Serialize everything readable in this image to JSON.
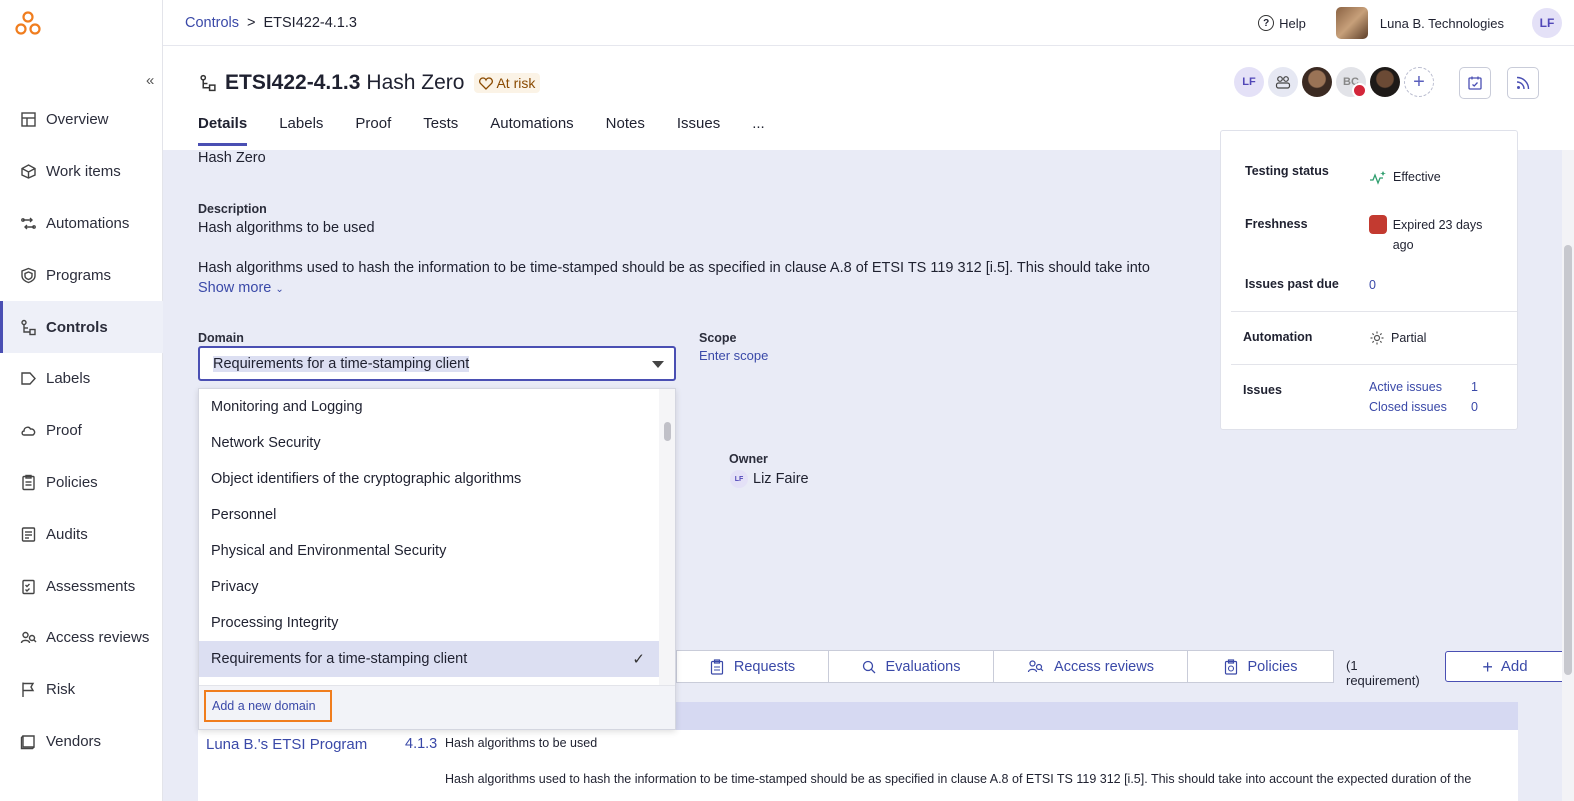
{
  "breadcrumb": {
    "root": "Controls",
    "sep": ">",
    "current": "ETSI422-4.1.3"
  },
  "topbar": {
    "help": "Help",
    "org": "Luna B. Technologies",
    "user_initials": "LF"
  },
  "control": {
    "code": "ETSI422-4.1.3",
    "name": "Hash Zero",
    "status": "At risk"
  },
  "tabs": [
    "Details",
    "Labels",
    "Proof",
    "Tests",
    "Automations",
    "Notes",
    "Issues",
    "..."
  ],
  "header_avatars": {
    "lf": "LF",
    "bc": "BC"
  },
  "sidebar": {
    "collapse": "«",
    "items": [
      {
        "label": "Overview",
        "icon": "overview-icon"
      },
      {
        "label": "Work items",
        "icon": "work-items-icon"
      },
      {
        "label": "Automations",
        "icon": "automations-icon"
      },
      {
        "label": "Programs",
        "icon": "programs-icon"
      },
      {
        "label": "Controls",
        "icon": "controls-icon"
      },
      {
        "label": "Labels",
        "icon": "labels-icon"
      },
      {
        "label": "Proof",
        "icon": "proof-icon"
      },
      {
        "label": "Policies",
        "icon": "policies-icon"
      },
      {
        "label": "Audits",
        "icon": "audits-icon"
      },
      {
        "label": "Assessments",
        "icon": "assessments-icon"
      },
      {
        "label": "Access reviews",
        "icon": "access-reviews-icon"
      },
      {
        "label": "Risk",
        "icon": "risk-icon"
      },
      {
        "label": "Vendors",
        "icon": "vendors-icon"
      }
    ]
  },
  "details": {
    "name_value": "Hash Zero",
    "description_label": "Description",
    "description_title": "Hash algorithms to be used",
    "description_body": "Hash algorithms used to hash the information to be time-stamped should be as specified in clause A.8 of ETSI TS 119 312 [i.5]. This should take into",
    "show_more": "Show more",
    "domain_label": "Domain",
    "domain_value": "Requirements for a time-stamping client",
    "scope_label": "Scope",
    "scope_link": "Enter scope",
    "owner_label": "Owner",
    "owner_initials": "LF",
    "owner_name": "Liz Faire"
  },
  "dropdown": {
    "options": [
      "Monitoring and Logging",
      "Network Security",
      "Object identifiers of the cryptographic algorithms",
      "Personnel",
      "Physical and Environmental Security",
      "Privacy",
      "Processing Integrity",
      "Requirements for a time-stamping client"
    ],
    "selected_index": 7,
    "add_new": "Add a new domain"
  },
  "summary": {
    "testing_status_label": "Testing status",
    "testing_status_value": "Effective",
    "freshness_label": "Freshness",
    "freshness_value": "Expired 23 days ago",
    "issues_past_due_label": "Issues past due",
    "issues_past_due_value": "0",
    "automation_label": "Automation",
    "automation_value": "Partial",
    "issues_label": "Issues",
    "active_issues_label": "Active issues",
    "active_issues_count": "1",
    "closed_issues_label": "Closed issues",
    "closed_issues_count": "0"
  },
  "related": {
    "tabs": [
      "Requests",
      "Evaluations",
      "Access reviews",
      "Policies"
    ],
    "count_text": "(1 requirement)",
    "add_label": "Add"
  },
  "requirement": {
    "program": "Luna B.'s ETSI Program",
    "number": "4.1.3",
    "title": "Hash algorithms to be used",
    "description": "Hash algorithms used to hash the information to be time-stamped should be as specified in clause A.8 of ETSI TS 119 312 [i.5]. This should take into account the expected duration of the"
  },
  "colors": {
    "accent": "#4a4fb3",
    "link": "#3a49a8",
    "at_risk_bg": "#fbf3e6",
    "content_bg": "#e9ebf6",
    "highlight": "#f07d1e"
  }
}
